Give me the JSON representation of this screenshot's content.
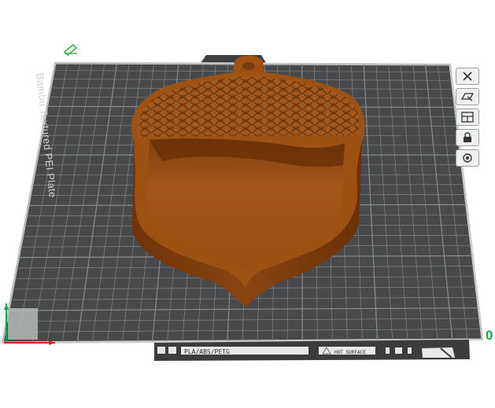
{
  "plate": {
    "label": "Bambu Textured PEI Plate",
    "filament_label": "PLA/ABS/PETG",
    "surface_label": "HOT SURFACE"
  },
  "model": {
    "name": "acorn",
    "color": "#9c5012"
  },
  "axis": {
    "origin_label": "0"
  },
  "toolbar": {
    "tools": [
      {
        "name": "close-icon"
      },
      {
        "name": "orient-icon"
      },
      {
        "name": "arrange-icon"
      },
      {
        "name": "lock-icon"
      },
      {
        "name": "settings-icon"
      }
    ]
  },
  "colors": {
    "bed": "#47494a",
    "grid": "#8a8d8e",
    "bed_border": "#d8dad9",
    "axis_x": "#e02020",
    "axis_y": "#17a24a"
  }
}
